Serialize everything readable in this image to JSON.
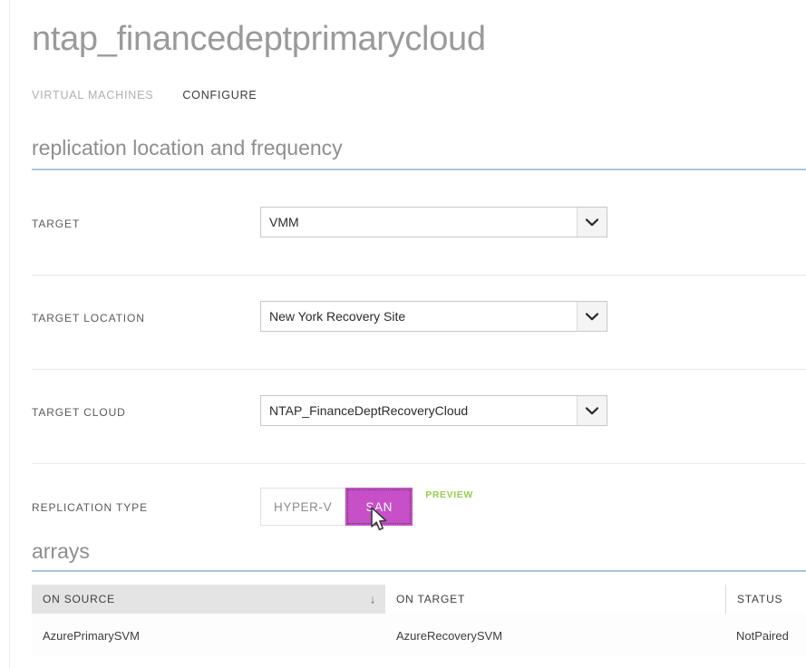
{
  "header": {
    "title": "ntap_financedeptprimarycloud",
    "tabs": [
      {
        "label": "VIRTUAL MACHINES",
        "active": false
      },
      {
        "label": "CONFIGURE",
        "active": true
      }
    ]
  },
  "sections": {
    "replication": {
      "title": "replication location and frequency"
    },
    "arrays": {
      "title": "arrays"
    }
  },
  "form": {
    "rows": [
      {
        "label": "TARGET",
        "value": "VMM"
      },
      {
        "label": "TARGET LOCATION",
        "value": "New York Recovery Site"
      },
      {
        "label": "TARGET CLOUD",
        "value": "NTAP_FinanceDeptRecoveryCloud"
      }
    ],
    "replication_type": {
      "label": "REPLICATION TYPE",
      "options": [
        {
          "label": "HYPER-V",
          "selected": false
        },
        {
          "label": "SAN",
          "selected": true
        }
      ],
      "preview_badge": "PREVIEW"
    }
  },
  "arrays_table": {
    "columns": [
      {
        "label": "ON SOURCE",
        "sorted": true,
        "sort_direction": "descending"
      },
      {
        "label": "ON TARGET",
        "sorted": false
      },
      {
        "label": "STATUS",
        "sorted": false
      }
    ],
    "rows": [
      {
        "on_source": "AzurePrimarySVM",
        "on_target": "AzureRecoverySVM",
        "status": "NotPaired"
      }
    ]
  },
  "colors": {
    "accent_rule": "#a9c5de",
    "selected_toggle": "#c74fc7",
    "preview_badge": "#9acd4e",
    "header_highlight": "#e4e4e4"
  },
  "icons": {
    "chevron_down": "chevron-down-icon",
    "sort_down_arrow": "↓",
    "cursor": "mouse-pointer-icon"
  }
}
